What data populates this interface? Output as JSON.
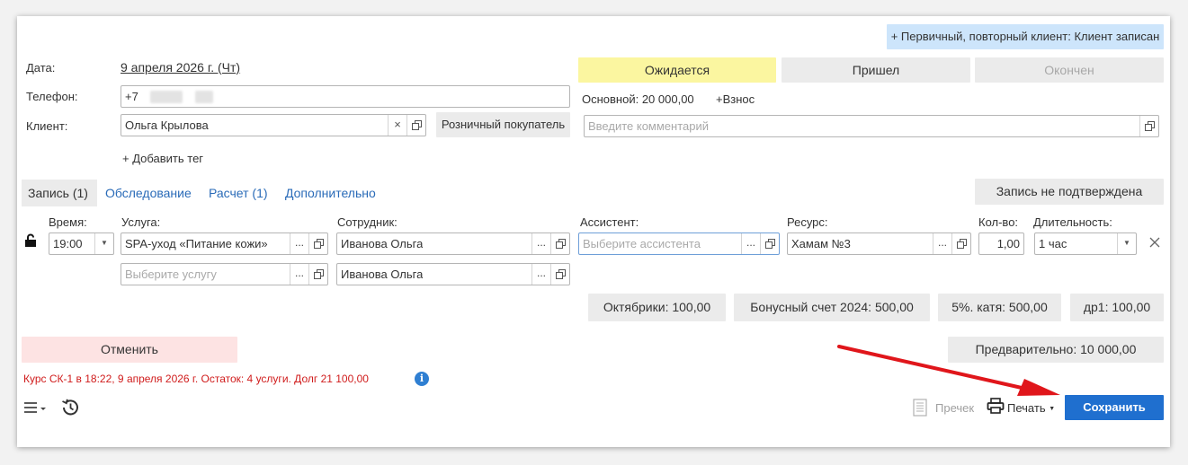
{
  "top_badge": "+ Первичный, повторный клиент: Клиент записан",
  "date": {
    "label": "Дата:",
    "value": "9 апреля 2026 г. (Чт)"
  },
  "phone": {
    "label": "Телефон:",
    "value": "+7"
  },
  "client": {
    "label": "Клиент:",
    "value": "Ольга Крылова",
    "retail_button": "Розничный покупатель"
  },
  "add_tag": "+ Добавить тег",
  "status": {
    "waiting": "Ожидается",
    "arrived": "Пришел",
    "finished": "Окончен"
  },
  "price": {
    "main": "Основной: 20 000,00",
    "contribution": "+Взнос"
  },
  "comment": {
    "placeholder": "Введите комментарий"
  },
  "tabs": [
    "Запись (1)",
    "Обследование",
    "Расчет (1)",
    "Дополнительно"
  ],
  "not_confirmed_button": "Запись не подтверждена",
  "columns": {
    "time": "Время:",
    "service": "Услуга:",
    "employee": "Сотрудник:",
    "assistant": "Ассистент:",
    "resource": "Ресурс:",
    "qty": "Кол-во:",
    "duration": "Длительность:"
  },
  "row": {
    "time": "19:00",
    "service": "SPA-уход «Питание кожи»",
    "service2_placeholder": "Выберите услугу",
    "employee": "Иванова Ольга",
    "employee2": "Иванова Ольга",
    "assistant_placeholder": "Выберите ассистента",
    "resource": "Хамам №3",
    "qty": "1,00",
    "duration": "1 час"
  },
  "balances": [
    "Октябрики: 100,00",
    "Бонусный счет 2024: 500,00",
    "5%. катя: 500,00",
    "др1: 100,00"
  ],
  "cancel_button": "Отменить",
  "preliminary": "Предварительно: 10 000,00",
  "course_info": "Курс СК-1 в 18:22, 9 апреля 2026 г. Остаток: 4 услуги. Долг 21 100,00",
  "footer": {
    "receipt": "Пречек",
    "print": "Печать",
    "save": "Сохранить"
  },
  "colors": {
    "waiting_bg": "#fbf6a0",
    "save_bg": "#1f6fcf",
    "cancel_bg": "#fde3e3",
    "badge_bg": "#cde5fb",
    "link": "#2a6bb8",
    "course_text": "#d01c1c",
    "arrow": "#e0161b"
  },
  "icons": [
    "lock-open-icon",
    "menu-icon",
    "history-icon",
    "info-icon",
    "receipt-icon",
    "printer-icon",
    "close-icon",
    "copy-icon",
    "chevron-down-icon"
  ]
}
